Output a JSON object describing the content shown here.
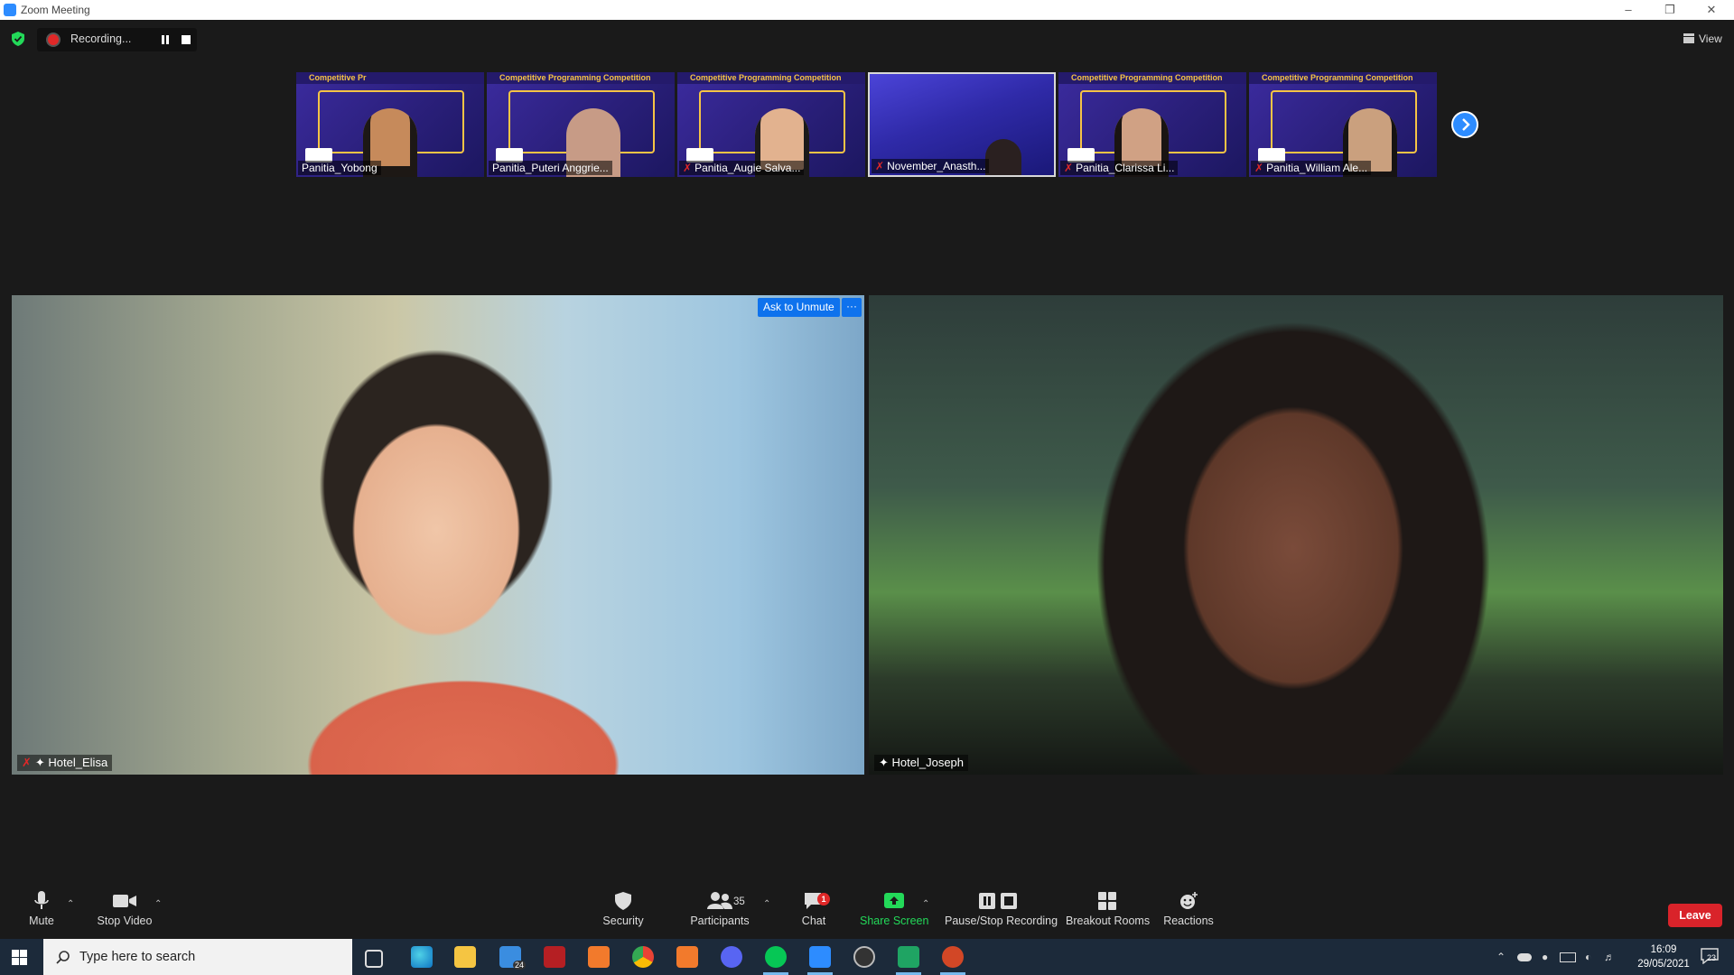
{
  "window": {
    "title": "Zoom Meeting"
  },
  "recording": {
    "label": "Recording..."
  },
  "view_button": {
    "label": "View"
  },
  "thumbnails": [
    {
      "name": "Panitia_Yobong",
      "banner": "Competitive Pr",
      "muted": false,
      "active": false,
      "person_color": "#c68a5b"
    },
    {
      "name": "Panitia_Puteri Anggrie...",
      "banner": "Competitive Programming Competition",
      "muted": false,
      "active": false,
      "person_color": "#c79b86"
    },
    {
      "name": "Panitia_Augie Salva...",
      "banner": "Competitive Programming Competition",
      "muted": true,
      "active": false,
      "person_color": "#e2b28f"
    },
    {
      "name": "November_Anasth...",
      "banner": "",
      "muted": true,
      "active": true,
      "person_color": "#2a2020"
    },
    {
      "name": "Panitia_Clarissa Li...",
      "banner": "Competitive Programming Competition",
      "muted": true,
      "active": false,
      "person_color": "#d0a184"
    },
    {
      "name": "Panitia_William Ale...",
      "banner": "Competitive Programming Competition",
      "muted": true,
      "active": false,
      "person_color": "#caa07e"
    }
  ],
  "videos": {
    "left": {
      "name": "Hotel_Elisa",
      "muted": true,
      "pinned": true
    },
    "right": {
      "name": "Hotel_Joseph",
      "muted": false,
      "pinned": true
    },
    "ask_unmute": "Ask to Unmute",
    "more": "···"
  },
  "toolbar": {
    "mute": "Mute",
    "stop_video": "Stop Video",
    "security": "Security",
    "participants": "Participants",
    "participants_count": "35",
    "chat": "Chat",
    "chat_badge": "1",
    "share_screen": "Share Screen",
    "pause_stop_recording": "Pause/Stop Recording",
    "breakout_rooms": "Breakout Rooms",
    "reactions": "Reactions",
    "leave": "Leave"
  },
  "taskbar": {
    "search_placeholder": "Type here to search",
    "mail_badge": "24",
    "time": "16:09",
    "date": "29/05/2021",
    "notifications": "23"
  },
  "colors": {
    "accent": "#2d8cff",
    "leave": "#d9232a",
    "share_green": "#23d959",
    "muted_red": "#e02828"
  }
}
